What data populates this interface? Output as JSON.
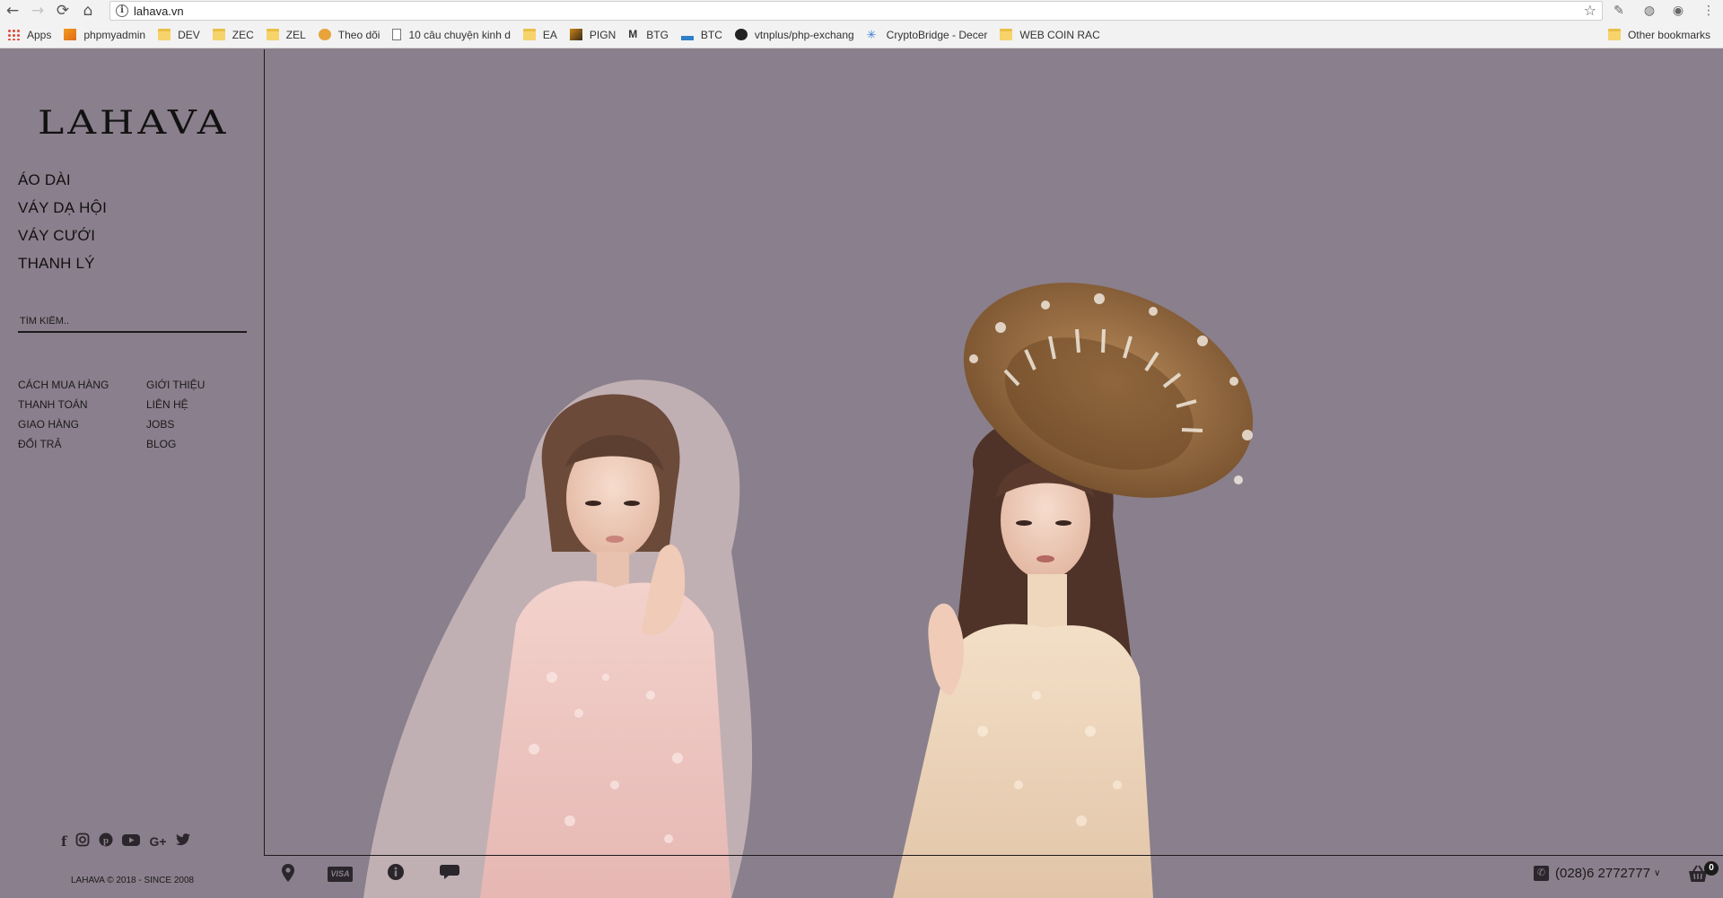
{
  "browser": {
    "url": "lahava.vn",
    "bookmarks": [
      {
        "label": "Apps",
        "icon": "apps-icon"
      },
      {
        "label": "phpmyadmin",
        "icon": "phpmyadmin-icon"
      },
      {
        "label": "DEV",
        "icon": "folder-icon"
      },
      {
        "label": "ZEC",
        "icon": "folder-icon"
      },
      {
        "label": "ZEL",
        "icon": "folder-icon"
      },
      {
        "label": "Theo dõi",
        "icon": "coin-icon"
      },
      {
        "label": "10 câu chuyện kinh d",
        "icon": "page-icon"
      },
      {
        "label": "EA",
        "icon": "folder-icon"
      },
      {
        "label": "PIGN",
        "icon": "image-icon"
      },
      {
        "label": "BTG",
        "icon": "m-icon"
      },
      {
        "label": "BTC",
        "icon": "chart-icon"
      },
      {
        "label": "vtnplus/php-exchang",
        "icon": "github-icon"
      },
      {
        "label": "CryptoBridge - Decer",
        "icon": "snowflake-icon"
      },
      {
        "label": "WEB COIN RAC",
        "icon": "folder-icon"
      }
    ],
    "other_bookmarks": "Other bookmarks"
  },
  "site": {
    "logo": "LAHAVA",
    "main_nav": [
      "ÁO DÀI",
      "VÁY DẠ HỘI",
      "VÁY CƯỚI",
      "THANH LÝ"
    ],
    "search_placeholder": "TÌM KIẾM..",
    "info_links": [
      "CÁCH MUA HÀNG",
      "GIỚI THIỆU",
      "THANH TOÁN",
      "LIÊN HỆ",
      "GIAO HÀNG",
      "JOBS",
      "ĐỔI TRẢ",
      "BLOG"
    ],
    "social": [
      "facebook-icon",
      "instagram-icon",
      "pinterest-icon",
      "youtube-icon",
      "google-plus-icon",
      "twitter-icon"
    ],
    "copyright": "LAHAVA © 2018 - SINCE 2008",
    "footer": {
      "visa": "VISA",
      "phone": "(028)6 2772777",
      "cart_count": "0"
    },
    "colors": {
      "background": "#8a7f8c",
      "text": "#111111"
    }
  }
}
